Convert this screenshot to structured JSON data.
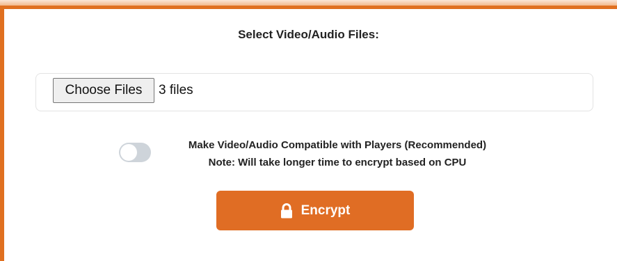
{
  "header": {
    "title": "Select Video/Audio Files:"
  },
  "file_input": {
    "button_label": "Choose Files",
    "selection_text": "3 files"
  },
  "compat_option": {
    "enabled": false,
    "label": "Make Video/Audio Compatible with Players (Recommended)",
    "note": "Note: Will take longer time to encrypt based on CPU"
  },
  "encrypt_button": {
    "label": "Encrypt",
    "icon": "lock-icon"
  },
  "colors": {
    "accent": "#e06d24",
    "toggle_off": "#ced4da"
  }
}
